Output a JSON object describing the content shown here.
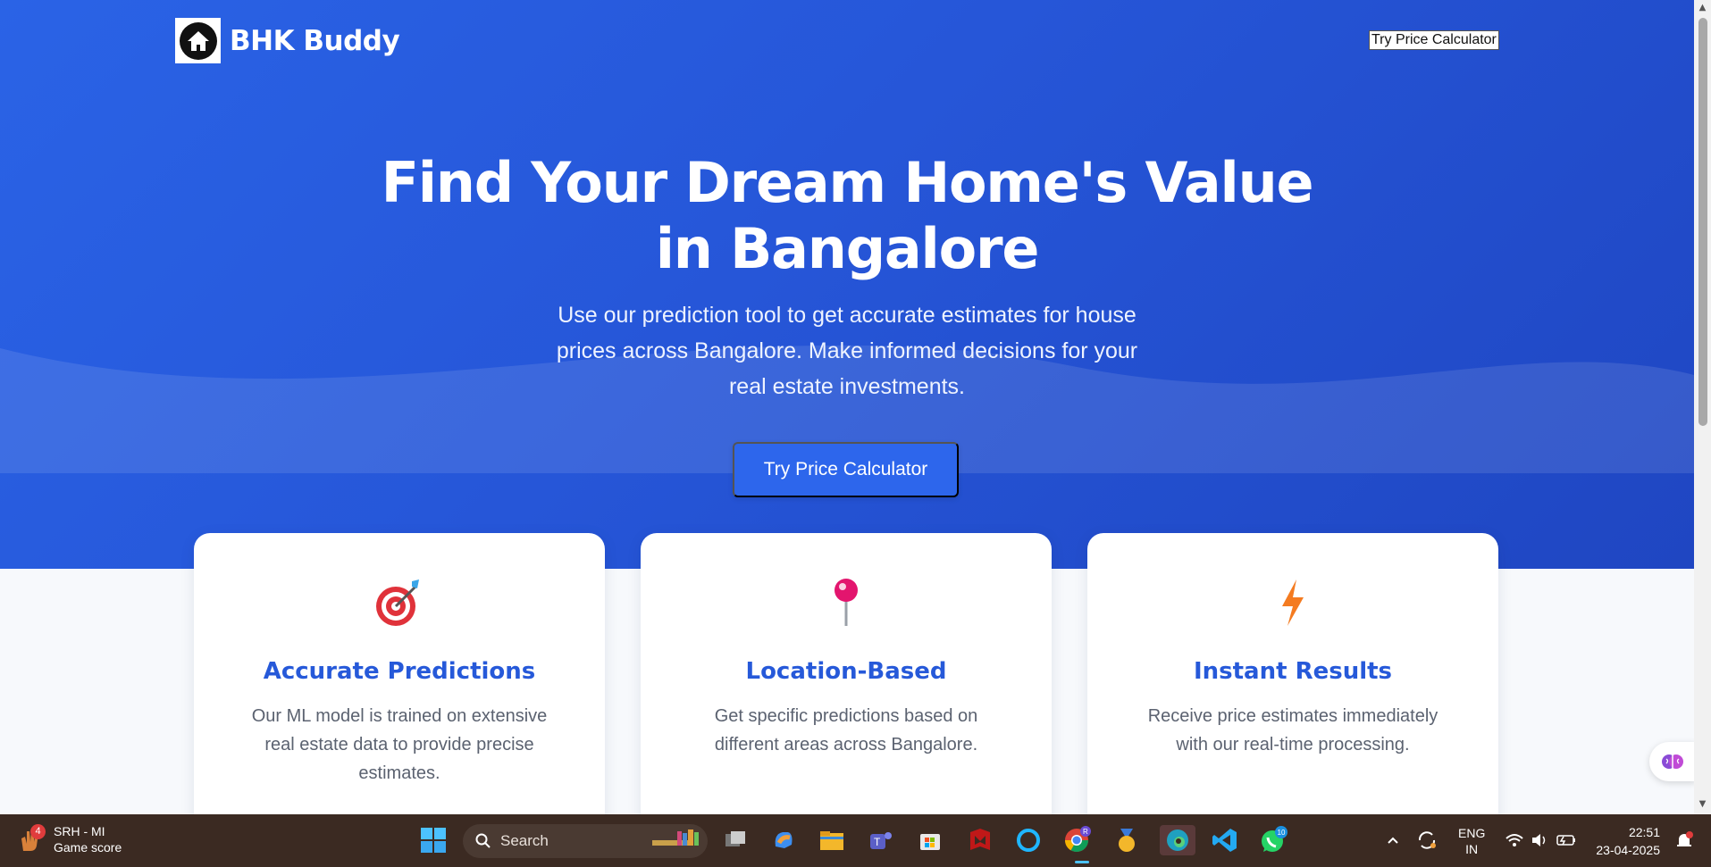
{
  "nav": {
    "brand": "BHK Buddy",
    "cta_label": "Try Price Calculator"
  },
  "hero": {
    "title_line1": "Find Your Dream Home's Value",
    "title_line2": "in Bangalore",
    "subtitle_line1": "Use our prediction tool to get accurate estimates for house",
    "subtitle_line2": "prices across Bangalore. Make informed decisions for your",
    "subtitle_line3": "real estate investments.",
    "cta_label": "Try Price Calculator"
  },
  "features": [
    {
      "icon": "target-dart-icon",
      "title": "Accurate Predictions",
      "line1": "Our ML model is trained on extensive",
      "line2": "real estate data to provide precise",
      "line3": "estimates."
    },
    {
      "icon": "map-pin-icon",
      "title": "Location-Based",
      "line1": "Get specific predictions based on",
      "line2": "different areas across Bangalore.",
      "line3": ""
    },
    {
      "icon": "lightning-icon",
      "title": "Instant Results",
      "line1": "Receive price estimates immediately",
      "line2": "with our real-time processing.",
      "line3": ""
    }
  ],
  "taskbar": {
    "game_title": "SRH - MI",
    "game_sub": "Game score",
    "game_badge": "4",
    "search_label": "Search",
    "teams_badge": "R",
    "whatsapp_badge": "10",
    "lang_line1": "ENG",
    "lang_line2": "IN",
    "time": "22:51",
    "date": "23-04-2025"
  },
  "colors": {
    "hero_bg": "#2656d8",
    "accent": "#2659d9",
    "taskbar_bg": "#3b2a22"
  }
}
